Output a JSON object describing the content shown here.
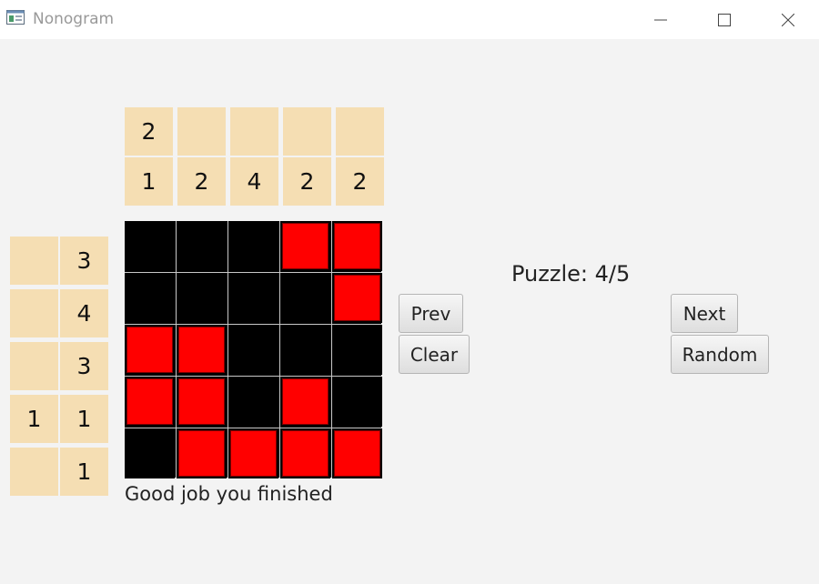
{
  "window": {
    "title": "Nonogram",
    "icon": "window-app-icon",
    "controls": [
      "minimize-icon",
      "maximize-icon",
      "close-icon"
    ]
  },
  "column_clues": {
    "top_row": [
      "2",
      "",
      "",
      "",
      ""
    ],
    "bottom_row": [
      "1",
      "2",
      "4",
      "2",
      "2"
    ]
  },
  "row_clues": [
    [
      "",
      "3"
    ],
    [
      "",
      "4"
    ],
    [
      "",
      "3"
    ],
    [
      "1",
      "1"
    ],
    [
      "",
      "1"
    ]
  ],
  "grid": {
    "rows": 5,
    "cols": 5,
    "cells": [
      [
        0,
        0,
        0,
        1,
        1
      ],
      [
        0,
        0,
        0,
        0,
        1
      ],
      [
        1,
        1,
        0,
        0,
        0
      ],
      [
        1,
        1,
        0,
        1,
        0
      ],
      [
        0,
        1,
        1,
        1,
        1
      ]
    ],
    "filled_color": "#ff0000",
    "empty_color": "#000000"
  },
  "status_text": "Good job you finished",
  "puzzle_label": "Puzzle: 4/5",
  "buttons": {
    "prev": "Prev",
    "clear": "Clear",
    "next": "Next",
    "random": "Random"
  },
  "colors": {
    "clue_background": "#f5deb3",
    "window_background": "#f3f3f3"
  }
}
